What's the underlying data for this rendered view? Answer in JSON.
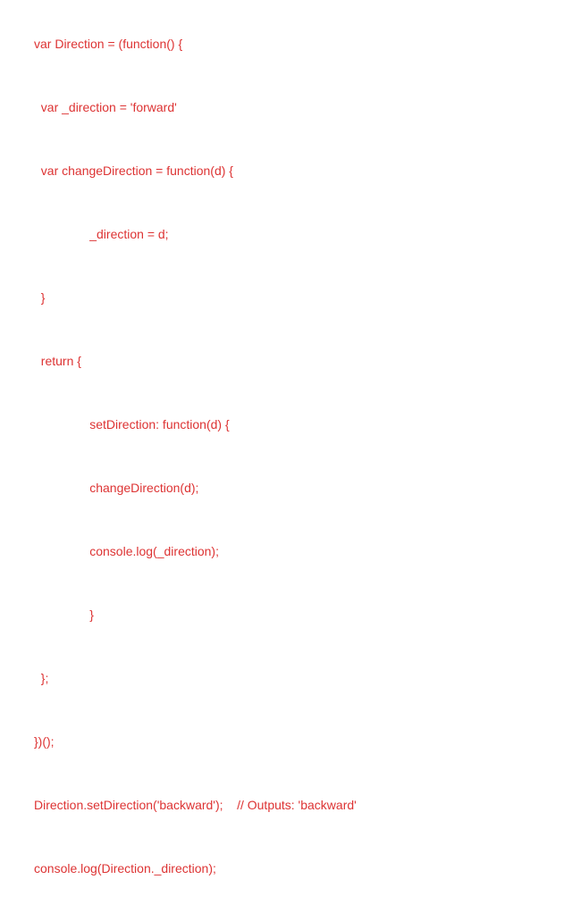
{
  "code": {
    "lines": [
      "var Direction = (function() {",
      "  var _direction = 'forward'",
      "  var changeDirection = function(d) {",
      "                _direction = d;",
      "  }",
      "  return {",
      "                setDirection: function(d) {",
      "                changeDirection(d);",
      "                console.log(_direction);",
      "                }",
      "  };",
      "})();",
      "Direction.setDirection('backward');    // Outputs: 'backward'",
      "console.log(Direction._direction);"
    ]
  }
}
